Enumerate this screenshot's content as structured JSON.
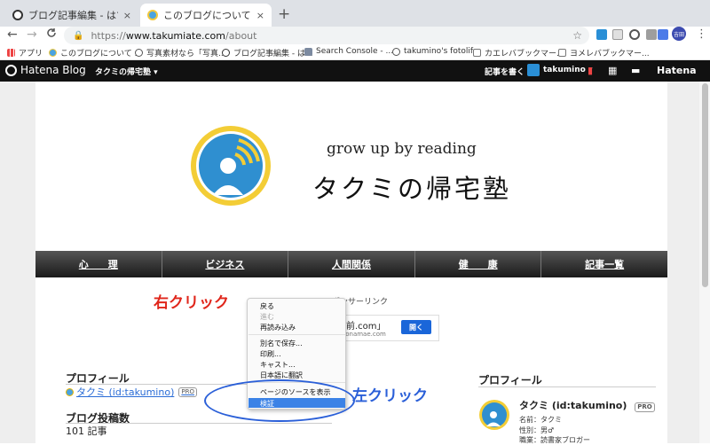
{
  "browser": {
    "tabs": [
      {
        "title": "ブログ記事編集 - はてなブログ",
        "close": "×"
      },
      {
        "title": "このブログについて - タクミの帰宅塾",
        "close": "×"
      }
    ],
    "new_tab": "+",
    "back": "←",
    "forward": "→",
    "reload": "C",
    "url_scheme": "https://",
    "url_host": "www.takumiate.com",
    "url_path": "/about",
    "star": "☆",
    "avatar_text": "吉田",
    "menu": "⋮"
  },
  "bookmarks": [
    {
      "label": "アプリ",
      "icon": "apps-grid-icon"
    },
    {
      "label": "このブログについて ...",
      "icon": "hatena-favicon-icon"
    },
    {
      "label": "写真素材なら「写真...",
      "icon": "camera-icon"
    },
    {
      "label": "ブログ記事編集 - は...",
      "icon": "hatena-favicon-icon"
    },
    {
      "label": "Search Console - ...",
      "icon": "search-console-icon"
    },
    {
      "label": "takumino's fotolife",
      "icon": "fotolife-icon"
    },
    {
      "label": "カエレバブックマー...",
      "icon": "page-icon"
    },
    {
      "label": "ヨメレバブックマー...",
      "icon": "page-icon"
    }
  ],
  "hatena_bar": {
    "logo": "Hatena Blog",
    "blog_name": "タクミの帰宅塾 ▾",
    "write": "記事を書く",
    "user": "takumino ▾",
    "brand": "Hatena"
  },
  "site": {
    "tagline": "grow up by reading",
    "title": "タクミの帰宅塾"
  },
  "nav": [
    "心　　理",
    "ビジネス",
    "人間関係",
    "健　　康",
    "記事一覧"
  ],
  "annotations": {
    "right_click": "右クリック",
    "left_click": "左クリック"
  },
  "ad": {
    "label": "スポンサーリンク",
    "title": "名前.com」",
    "sub": "ら onamae.com",
    "button": "開く"
  },
  "context_menu": {
    "items": [
      {
        "label": "戻る",
        "enabled": true
      },
      {
        "label": "進む",
        "enabled": false
      },
      {
        "label": "再読み込み",
        "enabled": true
      },
      {
        "label": "別名で保存...",
        "enabled": true
      },
      {
        "label": "印刷...",
        "enabled": true
      },
      {
        "label": "キャスト...",
        "enabled": true
      },
      {
        "label": "日本語に翻訳",
        "enabled": true
      },
      {
        "label": "ページのソースを表示",
        "enabled": true
      },
      {
        "label": "検証",
        "enabled": true,
        "highlighted": true
      }
    ]
  },
  "profile_left": {
    "heading": "プロフィール",
    "name": "タクミ (id:takumino)",
    "pro": "PRO",
    "posts_heading": "ブログ投稿数",
    "posts": "101 記事"
  },
  "profile_right": {
    "heading": "プロフィール",
    "name": "タクミ (id:takumino)",
    "pro": "PRO",
    "lines": [
      "名前：タクミ",
      "性別：男♂",
      "職業：読書家ブロガー"
    ]
  },
  "colors": {
    "right_click": "#e0261b",
    "left_click": "#2a5fd8",
    "highlight": "#3b82e6"
  }
}
